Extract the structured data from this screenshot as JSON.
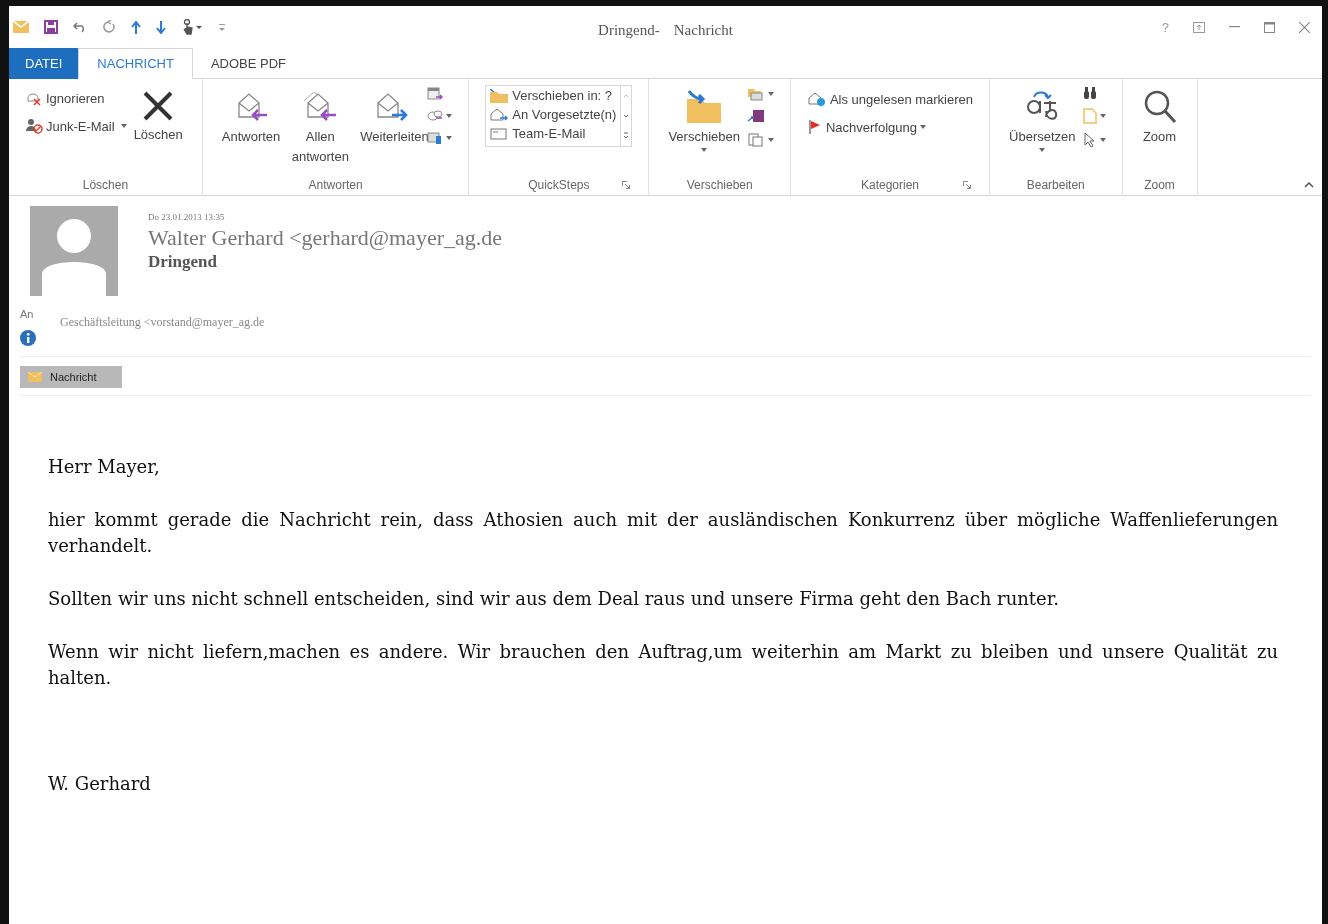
{
  "window": {
    "title_parts": [
      "Dringend-",
      "Nachricht"
    ],
    "help": "?"
  },
  "tabs": [
    {
      "label": "DATEI",
      "kind": "file",
      "selected": false
    },
    {
      "label": "NACHRICHT",
      "kind": "tab",
      "selected": true
    },
    {
      "label": "ADOBE PDF",
      "kind": "tab",
      "selected": false
    }
  ],
  "ribbon": {
    "groups": [
      {
        "label": "Löschen",
        "items": [
          "Ignorieren",
          "Junk-E-Mail",
          "Löschen"
        ]
      },
      {
        "label": "Antworten",
        "items": [
          "Antworten",
          "Allen antworten",
          "Weiterleiten"
        ]
      },
      {
        "label": "QuickSteps",
        "items": [
          "Verschieben in: ?",
          "An Vorgesetzte(n)",
          "Team-E-Mail"
        ]
      },
      {
        "label": "Verschieben",
        "items": [
          "Verschieben"
        ]
      },
      {
        "label": "Kategorien",
        "items": [
          "Als ungelesen markieren",
          "Nachverfolgung"
        ]
      },
      {
        "label": "Bearbeiten",
        "items": [
          "Übersetzen"
        ]
      },
      {
        "label": "Zoom",
        "items": [
          "Zoom"
        ]
      }
    ]
  },
  "message": {
    "date": "Do 23.01.2013 13:35",
    "sender": "Walter Gerhard <gerhard@mayer_ag.de",
    "subject": "Dringend",
    "to_label": "An",
    "to": "Geschäftsleitung <vorstand@mayer_ag.de",
    "attachments": [
      {
        "label": "Nachricht",
        "selected": true
      }
    ]
  },
  "body": {
    "greeting": "Herr Mayer,",
    "paragraphs": [
      "hier kommt gerade die Nachricht rein, dass Athosien auch mit der ausländischen Konkurrenz über mögliche Waffenlieferungen verhandelt.",
      "Sollten wir uns nicht schnell entscheiden, sind wir aus dem Deal raus und unsere Firma geht den Bach runter.",
      "Wenn wir nicht liefern,machen es andere. Wir brauchen den Auftrag,um weiterhin am Markt zu bleiben und unsere Qualität zu halten."
    ],
    "signature": "W. Gerhard"
  }
}
